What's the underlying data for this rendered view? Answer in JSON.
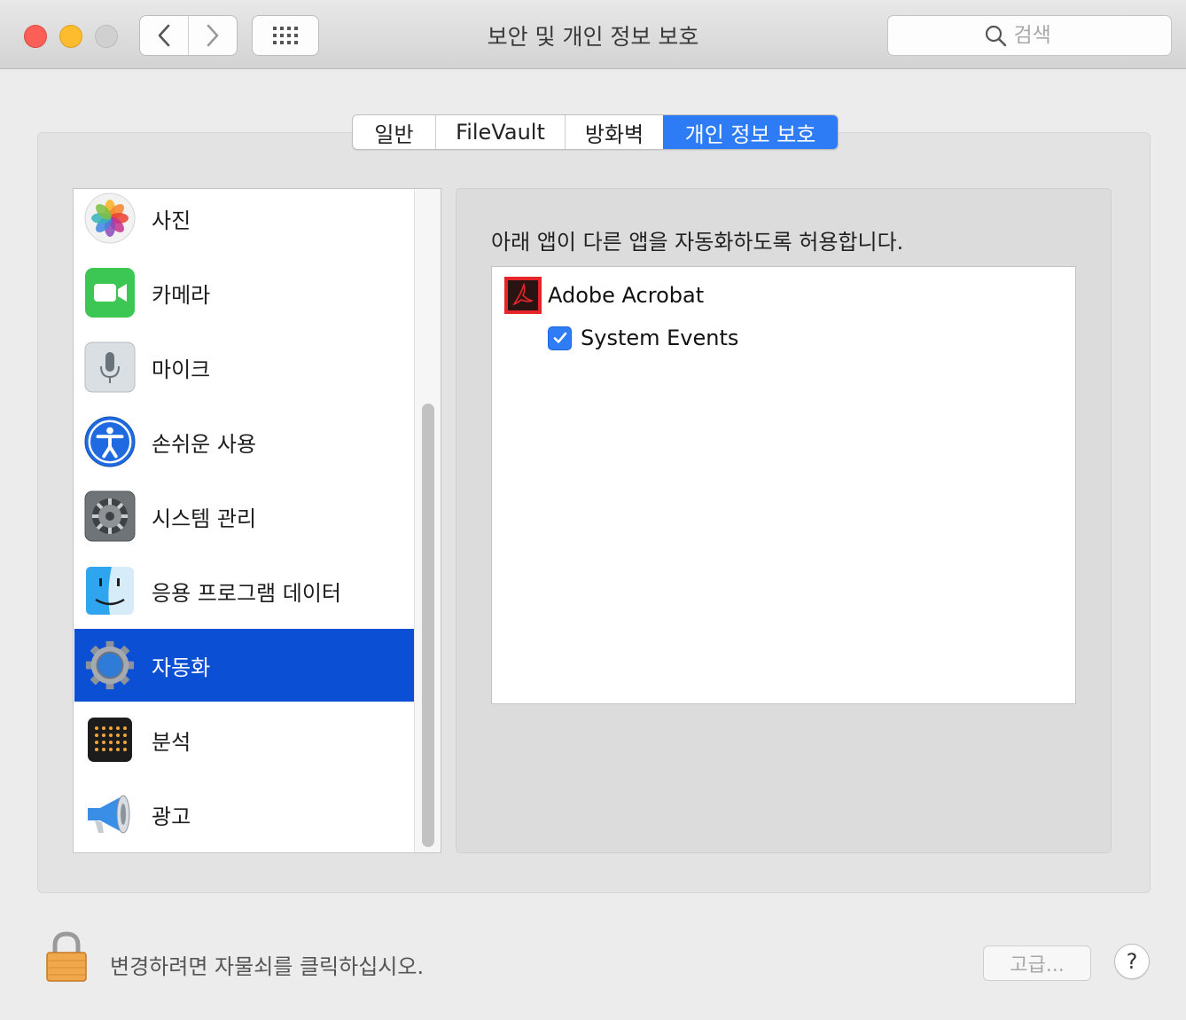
{
  "window": {
    "title": "보안 및 개인 정보 보호",
    "search_placeholder": "검색"
  },
  "tabs": [
    {
      "label": "일반",
      "active": false
    },
    {
      "label": "FileVault",
      "active": false
    },
    {
      "label": "방화벽",
      "active": false
    },
    {
      "label": "개인 정보 보호",
      "active": true
    }
  ],
  "sidebar": {
    "items": [
      {
        "label": "사진",
        "icon": "photos-icon"
      },
      {
        "label": "카메라",
        "icon": "camera-icon"
      },
      {
        "label": "마이크",
        "icon": "microphone-icon"
      },
      {
        "label": "손쉬운 사용",
        "icon": "accessibility-icon"
      },
      {
        "label": "시스템 관리",
        "icon": "system-gear-icon"
      },
      {
        "label": "응용 프로그램 데이터",
        "icon": "finder-icon"
      },
      {
        "label": "자동화",
        "icon": "automation-gear-icon",
        "selected": true
      },
      {
        "label": "분석",
        "icon": "analytics-icon"
      },
      {
        "label": "광고",
        "icon": "megaphone-icon"
      }
    ]
  },
  "main": {
    "description": "아래 앱이 다른 앱을 자동화하도록 허용합니다.",
    "app": {
      "name": "Adobe Acrobat",
      "icon": "adobe-acrobat-icon"
    },
    "permission": {
      "name": "System Events",
      "checked": true
    }
  },
  "footer": {
    "lock_text": "변경하려면 자물쇠를 클릭하십시오.",
    "advanced_label": "고급...",
    "help_label": "?"
  },
  "colors": {
    "accent": "#2d7cf6",
    "selection": "#0b4fd4"
  }
}
